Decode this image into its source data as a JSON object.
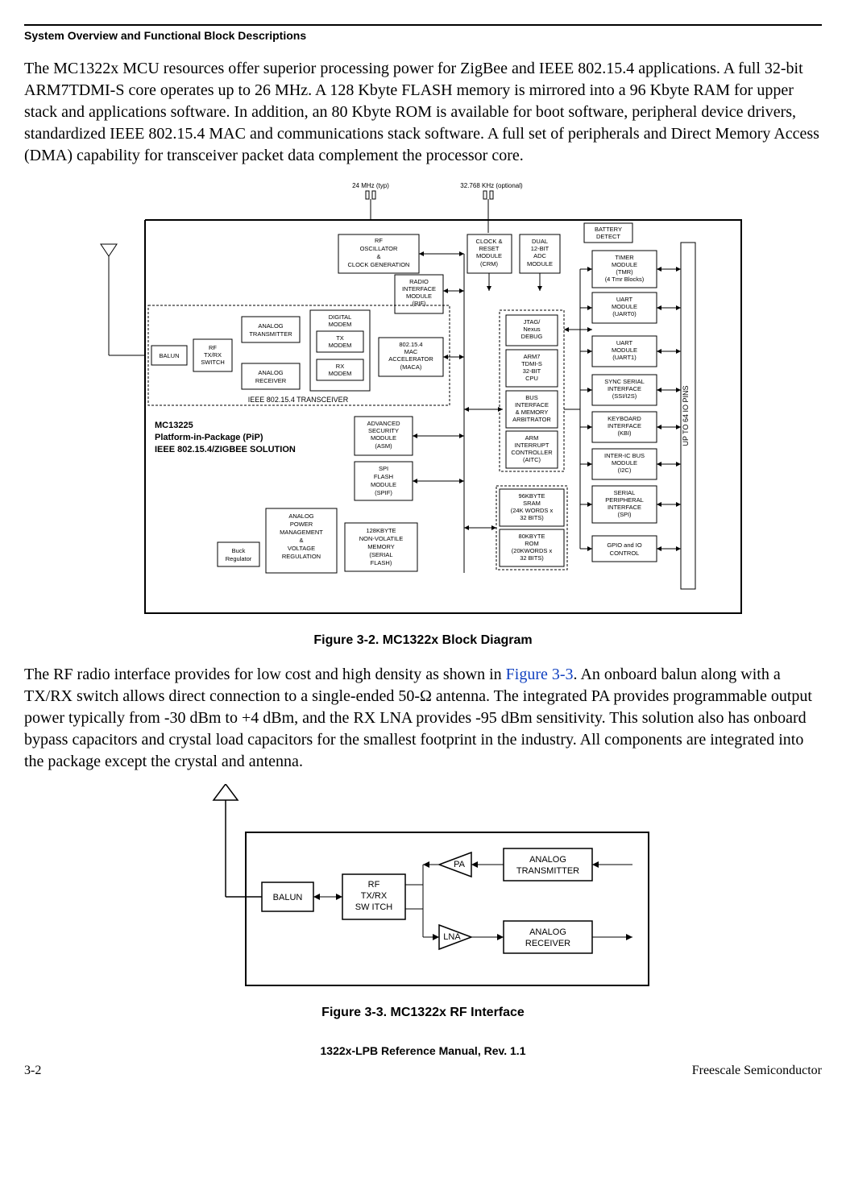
{
  "header": {
    "section_title": "System Overview and Functional Block Descriptions"
  },
  "paragraphs": {
    "p1": "The MC1322x MCU resources offer superior processing power for ZigBee and IEEE 802.15.4 applications. A full 32-bit ARM7TDMI-S core operates up to 26 MHz. A 128 Kbyte FLASH memory is mirrored into a 96 Kbyte RAM for upper stack and applications software. In addition, an 80 Kbyte ROM is available for boot software, peripheral device drivers, standardized IEEE 802.15.4 MAC and communications stack software. A full set of peripherals and Direct Memory Access (DMA) capability for transceiver packet data complement the processor core.",
    "p2_part1": "The RF radio interface provides for low cost and high density as shown in ",
    "p2_link": "Figure 3-3",
    "p2_part2": ". An onboard balun along with a TX/RX switch allows direct connection to a single-ended 50-Ω antenna. The integrated PA provides programmable output power typically from -30 dBm to +4 dBm, and the RX LNA provides -95 dBm sensitivity. This solution also has onboard bypass capacitors and crystal load capacitors for the smallest footprint in the industry. All components are integrated into the package except the crystal and antenna."
  },
  "figure1": {
    "caption": "Figure 3-2. MC1322x Block Diagram",
    "clock24": "24 MHz (typ)",
    "clock32": "32.768 KHz (optional)",
    "title_line1": "MC13225",
    "title_line2": "Platform-in-Package (PiP)",
    "title_line3": "IEEE 802.15.4/ZIGBEE SOLUTION",
    "transceiver_label": "IEEE 802.15.4 TRANSCEIVER",
    "io_pins_label": "UP TO 64 IO PINS",
    "blocks": {
      "balun": "BALUN",
      "rfswitch_l1": "RF",
      "rfswitch_l2": "TX/RX",
      "rfswitch_l3": "SWITCH",
      "atx_l1": "ANALOG",
      "atx_l2": "TRANSMITTER",
      "arx_l1": "ANALOG",
      "arx_l2": "RECEIVER",
      "dmodem_l1": "DIGITAL",
      "dmodem_l2": "MODEM",
      "txmodem_l1": "TX",
      "txmodem_l2": "MODEM",
      "rxmodem_l1": "RX",
      "rxmodem_l2": "MODEM",
      "rfosc_l1": "RF",
      "rfosc_l2": "OSCILLATOR",
      "rfosc_l3": "&",
      "rfosc_l4": "CLOCK GENERATION",
      "rif_l1": "RADIO",
      "rif_l2": "INTERFACE",
      "rif_l3": "MODULE",
      "rif_l4": "(RIF)",
      "maca_l1": "802.15.4",
      "maca_l2": "MAC",
      "maca_l3": "ACCELERATOR",
      "maca_l4": "(MACA)",
      "asm_l1": "ADVANCED",
      "asm_l2": "SECURITY",
      "asm_l3": "MODULE",
      "asm_l4": "(ASM)",
      "spif_l1": "SPI",
      "spif_l2": "FLASH",
      "spif_l3": "MODULE",
      "spif_l4": "(SPIF)",
      "nvm_l1": "128KBYTE",
      "nvm_l2": "NON-VOLATILE",
      "nvm_l3": "MEMORY",
      "nvm_l4": "(SERIAL",
      "nvm_l5": "FLASH)",
      "apm_l1": "ANALOG",
      "apm_l2": "POWER",
      "apm_l3": "MANAGEMENT",
      "apm_l4": "&",
      "apm_l5": "VOLTAGE",
      "apm_l6": "REGULATION",
      "buck_l1": "Buck",
      "buck_l2": "Regulator",
      "crm_l1": "CLOCK &",
      "crm_l2": "RESET",
      "crm_l3": "MODULE",
      "crm_l4": "(CRM)",
      "adc_l1": "DUAL",
      "adc_l2": "12-BIT",
      "adc_l3": "ADC",
      "adc_l4": "MODULE",
      "jtag_l1": "JTAG/",
      "jtag_l2": "Nexus",
      "jtag_l3": "DEBUG",
      "cpu_l1": "ARM7",
      "cpu_l2": "TDMI-S",
      "cpu_l3": "32-BIT",
      "cpu_l4": "CPU",
      "bus_l1": "BUS",
      "bus_l2": "INTERFACE",
      "bus_l3": "& MEMORY",
      "bus_l4": "ARBITRATOR",
      "aitc_l1": "ARM",
      "aitc_l2": "INTERRUPT",
      "aitc_l3": "CONTROLLER",
      "aitc_l4": "(AITC)",
      "sram_l1": "96KBYTE",
      "sram_l2": "SRAM",
      "sram_l3": "(24K WORDS x",
      "sram_l4": "32 BITS)",
      "rom_l1": "80KBYTE",
      "rom_l2": "ROM",
      "rom_l3": "(20KWORDS x",
      "rom_l4": "32 BITS)",
      "batt_l1": "BATTERY",
      "batt_l2": "DETECT",
      "tmr_l1": "TIMER",
      "tmr_l2": "MODULE",
      "tmr_l3": "(TMR)",
      "tmr_l4": "(4 Tmr Blocks)",
      "uart0_l1": "UART",
      "uart0_l2": "MODULE",
      "uart0_l3": "(UART0)",
      "uart1_l1": "UART",
      "uart1_l2": "MODULE",
      "uart1_l3": "(UART1)",
      "ssi_l1": "SYNC SERIAL",
      "ssi_l2": "INTERFACE",
      "ssi_l3": "(SSI/I2S)",
      "kbi_l1": "KEYBOARD",
      "kbi_l2": "INTERFACE",
      "kbi_l3": "(KBI)",
      "i2c_l1": "INTER-IC BUS",
      "i2c_l2": "MODULE",
      "i2c_l3": "(I2C)",
      "spi_l1": "SERIAL",
      "spi_l2": "PERIPHERAL",
      "spi_l3": "INTERFACE",
      "spi_l4": "(SPI)",
      "gpio_l1": "GPIO and IO",
      "gpio_l2": "CONTROL"
    }
  },
  "figure2": {
    "caption": "Figure 3-3. MC1322x RF Interface",
    "balun": "BALUN",
    "rfswitch_l1": "RF",
    "rfswitch_l2": "TX/RX",
    "rfswitch_l3": "SW ITCH",
    "pa": "PA",
    "lna": "LNA",
    "atx_l1": "ANALOG",
    "atx_l2": "TRANSMITTER",
    "arx_l1": "ANALOG",
    "arx_l2": "RECEIVER"
  },
  "footer": {
    "manual": "1322x-LPB Reference Manual, Rev. 1.1",
    "page": "3-2",
    "company": "Freescale Semiconductor"
  }
}
